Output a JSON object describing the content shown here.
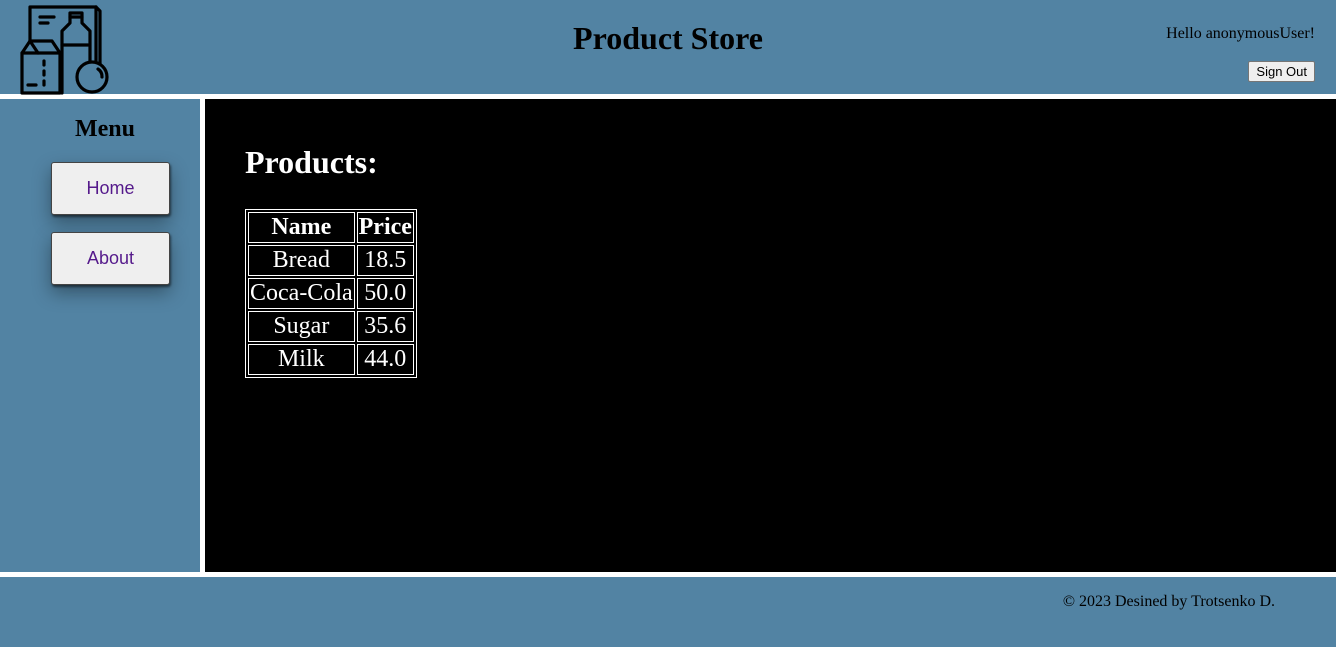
{
  "header": {
    "title": "Product Store",
    "greeting": "Hello anonymousUser!",
    "sign_out_label": "Sign Out",
    "logo_icon": "groceries-logo-icon"
  },
  "sidebar": {
    "title": "Menu",
    "items": [
      {
        "label": "Home"
      },
      {
        "label": "About"
      }
    ]
  },
  "main": {
    "heading": "Products:",
    "table": {
      "headers": [
        "Name",
        "Price"
      ],
      "rows": [
        [
          "Bread",
          "18.5"
        ],
        [
          "Coca-Cola",
          "50.0"
        ],
        [
          "Sugar",
          "35.6"
        ],
        [
          "Milk",
          "44.0"
        ]
      ]
    }
  },
  "footer": {
    "copyright": "© 2023 Desined by Trotsenko D."
  },
  "colors": {
    "panel": "#5283a3",
    "content_bg": "#000000",
    "link": "#551a8b"
  }
}
